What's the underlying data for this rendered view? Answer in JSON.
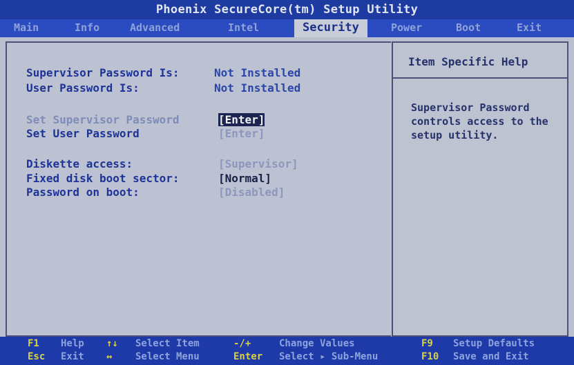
{
  "title": "Phoenix SecureCore(tm) Setup Utility",
  "menu": [
    {
      "label": "Main",
      "active": false
    },
    {
      "label": "Info",
      "active": false
    },
    {
      "label": "Advanced",
      "active": false
    },
    {
      "label": "Intel",
      "active": false
    },
    {
      "label": "Security",
      "active": true
    },
    {
      "label": "Power",
      "active": false
    },
    {
      "label": "Boot",
      "active": false
    },
    {
      "label": "Exit",
      "active": false
    }
  ],
  "status": {
    "supervisor_label": "Supervisor Password Is:",
    "supervisor_value": "Not Installed",
    "user_label": "User Password Is:",
    "user_value": "Not Installed"
  },
  "items": [
    {
      "label": "Set Supervisor Password",
      "value": "[Enter]"
    },
    {
      "label": "Set User Password",
      "value": "[Enter]"
    },
    {
      "label": "Diskette access:",
      "value": "[Supervisor]"
    },
    {
      "label": "Fixed disk boot sector:",
      "value": "[Normal]"
    },
    {
      "label": "Password on boot:",
      "value": "[Disabled]"
    }
  ],
  "help": {
    "title": "Item Specific Help",
    "text": "Supervisor Password controls access to the setup utility."
  },
  "footer": {
    "f1_key": "F1",
    "f1_label": "Help",
    "updown_key": "↑↓",
    "updown_label": "Select Item",
    "plusminus_key": "-/+",
    "plusminus_label": "Change Values",
    "f9_key": "F9",
    "f9_label": "Setup Defaults",
    "esc_key": "Esc",
    "esc_label": "Exit",
    "leftright_key": "↔",
    "leftright_label": "Select Menu",
    "enter_key": "Enter",
    "enter_label": "Select ▸ Sub-Menu",
    "f10_key": "F10",
    "f10_label": "Save and Exit"
  }
}
